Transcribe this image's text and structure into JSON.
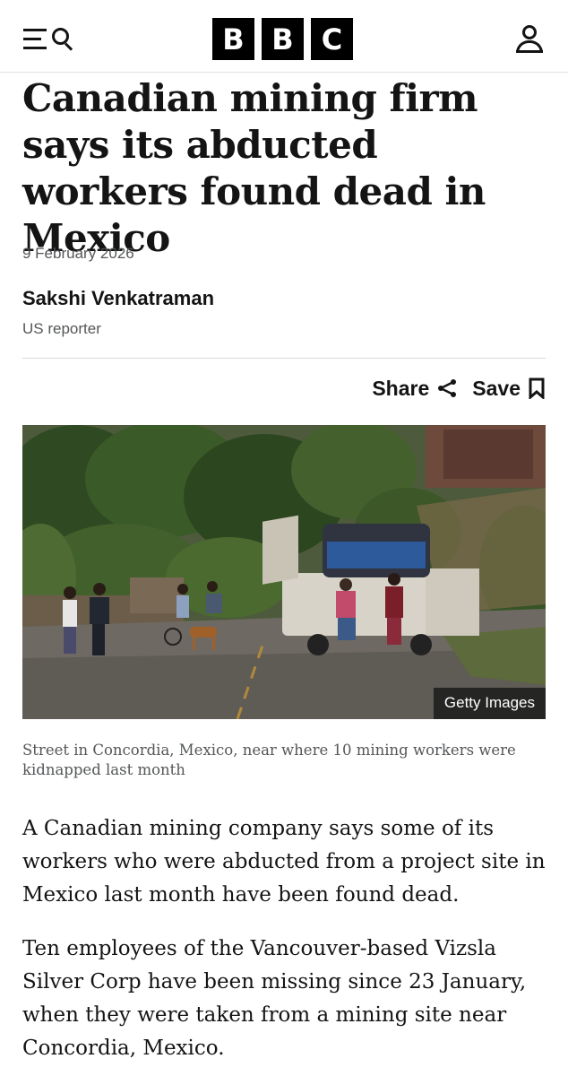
{
  "header": {
    "logo_letters": [
      "B",
      "B",
      "C"
    ],
    "menu_icon": "menu-search-icon",
    "account_icon": "account-icon"
  },
  "article": {
    "headline": "Canadian mining firm says its abducted workers found dead in Mexico",
    "date": "9 February 2026",
    "author": "Sakshi Venkatraman",
    "author_role": "US reporter",
    "share_label": "Share",
    "save_label": "Save",
    "image_credit": "Getty Images",
    "image_caption": "Street in Concordia, Mexico, near where 10 mining workers were kidnapped last month",
    "paragraphs": [
      "A Canadian mining company says some of its workers who were abducted from a project site in Mexico last month have been found dead.",
      "Ten employees of the Vancouver-based Vizsla Silver Corp have been missing since 23 January, when they were taken from a mining site near Concordia, Mexico."
    ]
  },
  "colors": {
    "text": "#141414",
    "muted": "#545658",
    "logo_bg": "#000000"
  }
}
